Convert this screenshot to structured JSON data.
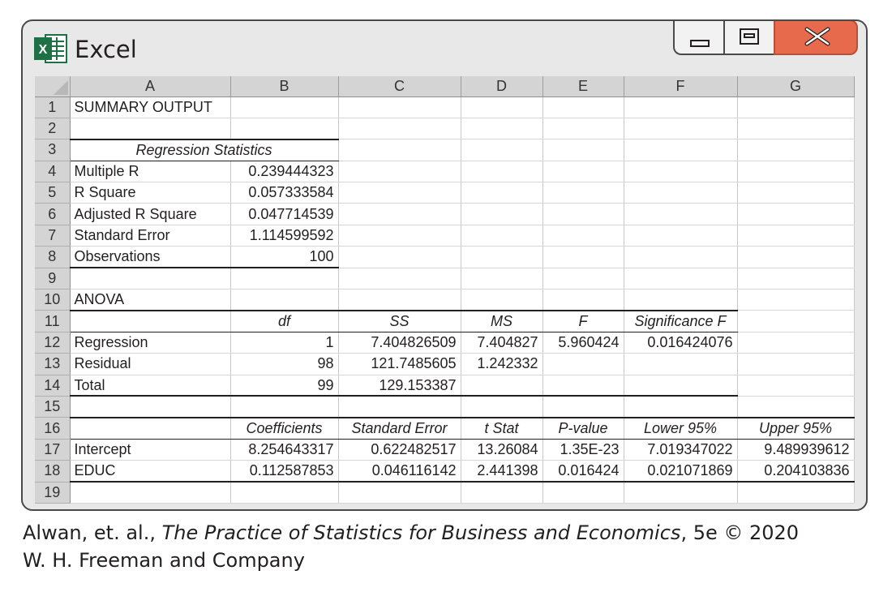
{
  "window": {
    "app_title": "Excel",
    "logo_letter": "X",
    "colors": {
      "logo": "#1e7145",
      "close": "#e86a4d",
      "frame": "#4a4a4a"
    },
    "controls": [
      "minimize-icon",
      "maximize-icon",
      "close-icon"
    ]
  },
  "columns": [
    "A",
    "B",
    "C",
    "D",
    "E",
    "F",
    "G"
  ],
  "rows": [
    [
      "SUMMARY OUTPUT",
      "",
      "",
      "",
      "",
      "",
      ""
    ],
    [
      "",
      "",
      "",
      "",
      "",
      "",
      ""
    ],
    [
      "Regression Statistics",
      "",
      "",
      "",
      "",
      "",
      ""
    ],
    [
      "Multiple R",
      "0.239444323",
      "",
      "",
      "",
      "",
      ""
    ],
    [
      "R Square",
      "0.057333584",
      "",
      "",
      "",
      "",
      ""
    ],
    [
      "Adjusted R Square",
      "0.047714539",
      "",
      "",
      "",
      "",
      ""
    ],
    [
      "Standard Error",
      "1.114599592",
      "",
      "",
      "",
      "",
      ""
    ],
    [
      "Observations",
      "100",
      "",
      "",
      "",
      "",
      ""
    ],
    [
      "",
      "",
      "",
      "",
      "",
      "",
      ""
    ],
    [
      "ANOVA",
      "",
      "",
      "",
      "",
      "",
      ""
    ],
    [
      "",
      "df",
      "SS",
      "MS",
      "F",
      "Significance F",
      ""
    ],
    [
      "Regression",
      "1",
      "7.404826509",
      "7.404827",
      "5.960424",
      "0.016424076",
      ""
    ],
    [
      "Residual",
      "98",
      "121.7485605",
      "1.242332",
      "",
      "",
      ""
    ],
    [
      "Total",
      "99",
      "129.153387",
      "",
      "",
      "",
      ""
    ],
    [
      "",
      "",
      "",
      "",
      "",
      "",
      ""
    ],
    [
      "",
      "Coefficients",
      "Standard Error",
      "t Stat",
      "P-value",
      "Lower 95%",
      "Upper 95%"
    ],
    [
      "Intercept",
      "8.254643317",
      "0.622482517",
      "13.26084",
      "1.35E-23",
      "7.019347022",
      "9.489939612"
    ],
    [
      "EDUC",
      "0.112587853",
      "0.046116142",
      "2.441398",
      "0.016424",
      "0.021071869",
      "0.204103836"
    ]
  ],
  "caption": {
    "authors": "Alwan, et. al., ",
    "book": "The Practice of Statistics for Business and Economics",
    "edition": ", 5e © 2020",
    "publisher": "W. H. Freeman and Company"
  }
}
